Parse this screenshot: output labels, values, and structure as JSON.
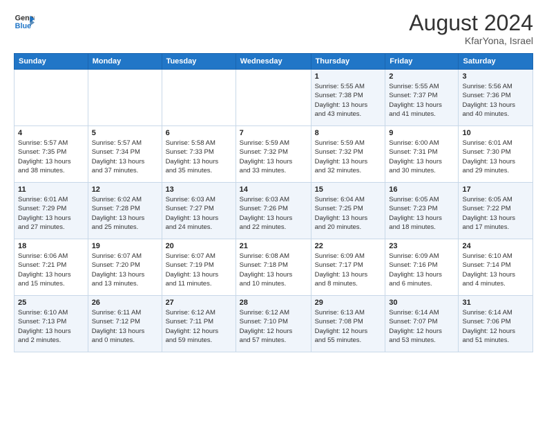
{
  "header": {
    "logo_line1": "General",
    "logo_line2": "Blue",
    "month": "August 2024",
    "location": "KfarYona, Israel"
  },
  "days_of_week": [
    "Sunday",
    "Monday",
    "Tuesday",
    "Wednesday",
    "Thursday",
    "Friday",
    "Saturday"
  ],
  "weeks": [
    [
      {
        "num": "",
        "info": ""
      },
      {
        "num": "",
        "info": ""
      },
      {
        "num": "",
        "info": ""
      },
      {
        "num": "",
        "info": ""
      },
      {
        "num": "1",
        "info": "Sunrise: 5:55 AM\nSunset: 7:38 PM\nDaylight: 13 hours\nand 43 minutes."
      },
      {
        "num": "2",
        "info": "Sunrise: 5:55 AM\nSunset: 7:37 PM\nDaylight: 13 hours\nand 41 minutes."
      },
      {
        "num": "3",
        "info": "Sunrise: 5:56 AM\nSunset: 7:36 PM\nDaylight: 13 hours\nand 40 minutes."
      }
    ],
    [
      {
        "num": "4",
        "info": "Sunrise: 5:57 AM\nSunset: 7:35 PM\nDaylight: 13 hours\nand 38 minutes."
      },
      {
        "num": "5",
        "info": "Sunrise: 5:57 AM\nSunset: 7:34 PM\nDaylight: 13 hours\nand 37 minutes."
      },
      {
        "num": "6",
        "info": "Sunrise: 5:58 AM\nSunset: 7:33 PM\nDaylight: 13 hours\nand 35 minutes."
      },
      {
        "num": "7",
        "info": "Sunrise: 5:59 AM\nSunset: 7:32 PM\nDaylight: 13 hours\nand 33 minutes."
      },
      {
        "num": "8",
        "info": "Sunrise: 5:59 AM\nSunset: 7:32 PM\nDaylight: 13 hours\nand 32 minutes."
      },
      {
        "num": "9",
        "info": "Sunrise: 6:00 AM\nSunset: 7:31 PM\nDaylight: 13 hours\nand 30 minutes."
      },
      {
        "num": "10",
        "info": "Sunrise: 6:01 AM\nSunset: 7:30 PM\nDaylight: 13 hours\nand 29 minutes."
      }
    ],
    [
      {
        "num": "11",
        "info": "Sunrise: 6:01 AM\nSunset: 7:29 PM\nDaylight: 13 hours\nand 27 minutes."
      },
      {
        "num": "12",
        "info": "Sunrise: 6:02 AM\nSunset: 7:28 PM\nDaylight: 13 hours\nand 25 minutes."
      },
      {
        "num": "13",
        "info": "Sunrise: 6:03 AM\nSunset: 7:27 PM\nDaylight: 13 hours\nand 24 minutes."
      },
      {
        "num": "14",
        "info": "Sunrise: 6:03 AM\nSunset: 7:26 PM\nDaylight: 13 hours\nand 22 minutes."
      },
      {
        "num": "15",
        "info": "Sunrise: 6:04 AM\nSunset: 7:25 PM\nDaylight: 13 hours\nand 20 minutes."
      },
      {
        "num": "16",
        "info": "Sunrise: 6:05 AM\nSunset: 7:23 PM\nDaylight: 13 hours\nand 18 minutes."
      },
      {
        "num": "17",
        "info": "Sunrise: 6:05 AM\nSunset: 7:22 PM\nDaylight: 13 hours\nand 17 minutes."
      }
    ],
    [
      {
        "num": "18",
        "info": "Sunrise: 6:06 AM\nSunset: 7:21 PM\nDaylight: 13 hours\nand 15 minutes."
      },
      {
        "num": "19",
        "info": "Sunrise: 6:07 AM\nSunset: 7:20 PM\nDaylight: 13 hours\nand 13 minutes."
      },
      {
        "num": "20",
        "info": "Sunrise: 6:07 AM\nSunset: 7:19 PM\nDaylight: 13 hours\nand 11 minutes."
      },
      {
        "num": "21",
        "info": "Sunrise: 6:08 AM\nSunset: 7:18 PM\nDaylight: 13 hours\nand 10 minutes."
      },
      {
        "num": "22",
        "info": "Sunrise: 6:09 AM\nSunset: 7:17 PM\nDaylight: 13 hours\nand 8 minutes."
      },
      {
        "num": "23",
        "info": "Sunrise: 6:09 AM\nSunset: 7:16 PM\nDaylight: 13 hours\nand 6 minutes."
      },
      {
        "num": "24",
        "info": "Sunrise: 6:10 AM\nSunset: 7:14 PM\nDaylight: 13 hours\nand 4 minutes."
      }
    ],
    [
      {
        "num": "25",
        "info": "Sunrise: 6:10 AM\nSunset: 7:13 PM\nDaylight: 13 hours\nand 2 minutes."
      },
      {
        "num": "26",
        "info": "Sunrise: 6:11 AM\nSunset: 7:12 PM\nDaylight: 13 hours\nand 0 minutes."
      },
      {
        "num": "27",
        "info": "Sunrise: 6:12 AM\nSunset: 7:11 PM\nDaylight: 12 hours\nand 59 minutes."
      },
      {
        "num": "28",
        "info": "Sunrise: 6:12 AM\nSunset: 7:10 PM\nDaylight: 12 hours\nand 57 minutes."
      },
      {
        "num": "29",
        "info": "Sunrise: 6:13 AM\nSunset: 7:08 PM\nDaylight: 12 hours\nand 55 minutes."
      },
      {
        "num": "30",
        "info": "Sunrise: 6:14 AM\nSunset: 7:07 PM\nDaylight: 12 hours\nand 53 minutes."
      },
      {
        "num": "31",
        "info": "Sunrise: 6:14 AM\nSunset: 7:06 PM\nDaylight: 12 hours\nand 51 minutes."
      }
    ]
  ]
}
